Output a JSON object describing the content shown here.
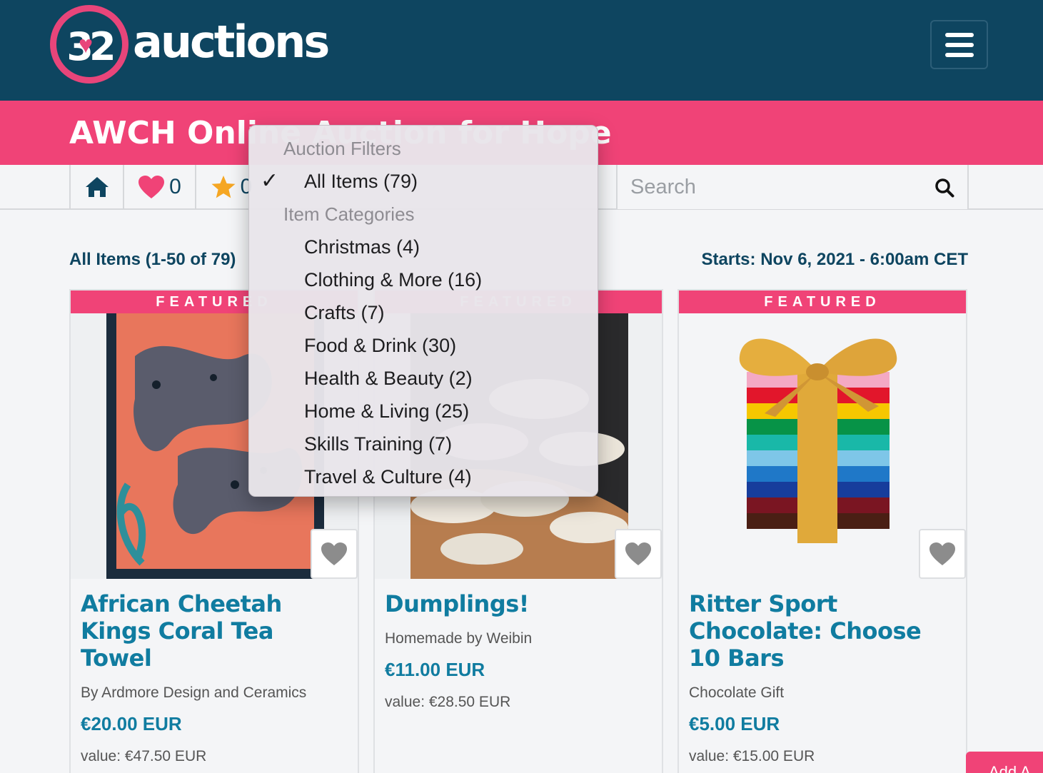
{
  "header": {
    "logo_number": "32",
    "logo_text": "auctions"
  },
  "title_bar": {
    "title": "AWCH Online Auction for Hope"
  },
  "toolbar": {
    "favorites_count": "0",
    "starred_count": "0",
    "search_placeholder": "Search"
  },
  "list": {
    "count_label": "All Items (1-50 of 79)",
    "starts_label": "Starts: Nov 6, 2021 - 6:00am CET"
  },
  "cards": [
    {
      "banner": "FEATURED",
      "title": "African Cheetah Kings Coral Tea Towel",
      "subtitle": "By Ardmore Design and Ceramics",
      "price": "€20.00 EUR",
      "value": "value: €47.50 EUR"
    },
    {
      "banner": "FEATURED",
      "title": "Dumplings!",
      "subtitle": "Homemade by Weibin",
      "price": "€11.00 EUR",
      "value": "value: €28.50 EUR"
    },
    {
      "banner": "FEATURED",
      "title": "Ritter Sport Chocolate: Choose 10 Bars",
      "subtitle": "Chocolate Gift",
      "price": "€5.00 EUR",
      "value": "value: €15.00 EUR"
    }
  ],
  "add_button": {
    "label": "Add A"
  },
  "dropdown": {
    "section_filters": "Auction Filters",
    "selected": "All Items (79)",
    "section_categories": "Item Categories",
    "categories": [
      "Christmas (4)",
      "Clothing & More (16)",
      "Crafts (7)",
      "Food & Drink (30)",
      "Health & Beauty (2)",
      "Home & Living (25)",
      "Skills Training (7)",
      "Travel & Culture (4)"
    ]
  },
  "colors": {
    "header_navy": "#0e4560",
    "brand_pink": "#f04377",
    "link_blue": "#107ca0"
  }
}
